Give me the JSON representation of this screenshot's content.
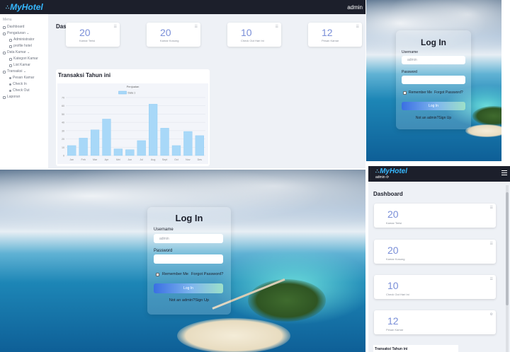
{
  "app": {
    "brand": "MyHotel",
    "user": "admin"
  },
  "sidebar": {
    "caption": "Menu",
    "items": [
      {
        "label": "Dashboard",
        "level": 0,
        "icon": "home-icon"
      },
      {
        "label": "Pengaturan ⌄",
        "level": 0,
        "icon": "gear-icon"
      },
      {
        "label": "Administrator",
        "level": 1,
        "icon": "user-icon"
      },
      {
        "label": "profile hotel",
        "level": 1,
        "icon": "building-icon"
      },
      {
        "label": "Data Kamar ⌄",
        "level": 0,
        "icon": "bed-icon"
      },
      {
        "label": "Kategori Kamar",
        "level": 1,
        "icon": "tag-icon"
      },
      {
        "label": "List Kamar",
        "level": 1,
        "icon": "list-icon"
      },
      {
        "label": "Transaksi ⌄",
        "level": 0,
        "icon": "cart-icon"
      },
      {
        "label": "Pesan Kamar",
        "level": 1,
        "icon": "circle-icon"
      },
      {
        "label": "Check In",
        "level": 1,
        "icon": "circle-icon"
      },
      {
        "label": "Check Out",
        "level": 1,
        "icon": "circle-icon"
      },
      {
        "label": "Laporan",
        "level": 0,
        "icon": "report-icon"
      }
    ]
  },
  "dashboard": {
    "title": "Dashboard",
    "stats": [
      {
        "value": "20",
        "label": "Kamar Terisi"
      },
      {
        "value": "20",
        "label": "Kamar Kosong"
      },
      {
        "value": "10",
        "label": "Check Out Hari Ini"
      },
      {
        "value": "12",
        "label": "Pesan Kamar"
      }
    ],
    "chart_title": "Transaksi Tahun ini"
  },
  "chart_data": {
    "type": "bar",
    "title": "Penjualan",
    "categories": [
      "Jan",
      "Feb",
      "Mar",
      "Apr",
      "Mei",
      "Jun",
      "Jul",
      "Aug",
      "Sept",
      "Oct",
      "Nov",
      "Des"
    ],
    "series": [
      {
        "name": "Data 1",
        "values": [
          12,
          21,
          31,
          44,
          8,
          7,
          18,
          62,
          33,
          12,
          29,
          24
        ],
        "color": "#a8d8f8"
      }
    ],
    "ylim": [
      0,
      70
    ],
    "yticks": [
      "0",
      "10",
      "20",
      "30",
      "40",
      "50",
      "60",
      "70"
    ],
    "grid": true,
    "legend": "top"
  },
  "login": {
    "title": "Log In",
    "username_label": "Username",
    "username_value": "admin",
    "password_label": "Password",
    "remember_label": "Remember Me",
    "forgot_label": "Forgot Password?",
    "button_label": "Log In",
    "signup_label": "Not an admin?Sign Up"
  },
  "mobile": {
    "title": "Dashboard",
    "user": "admin",
    "chart_title": "Transaksi Tahun ini"
  },
  "colors": {
    "topbar": "#1c1f2b",
    "brand": "#36b8ff",
    "stat_number": "#7a8fd8",
    "bar": "#a8d8f8",
    "button_gradient_start": "#3a6fe3",
    "button_gradient_end": "#9de0c8"
  }
}
